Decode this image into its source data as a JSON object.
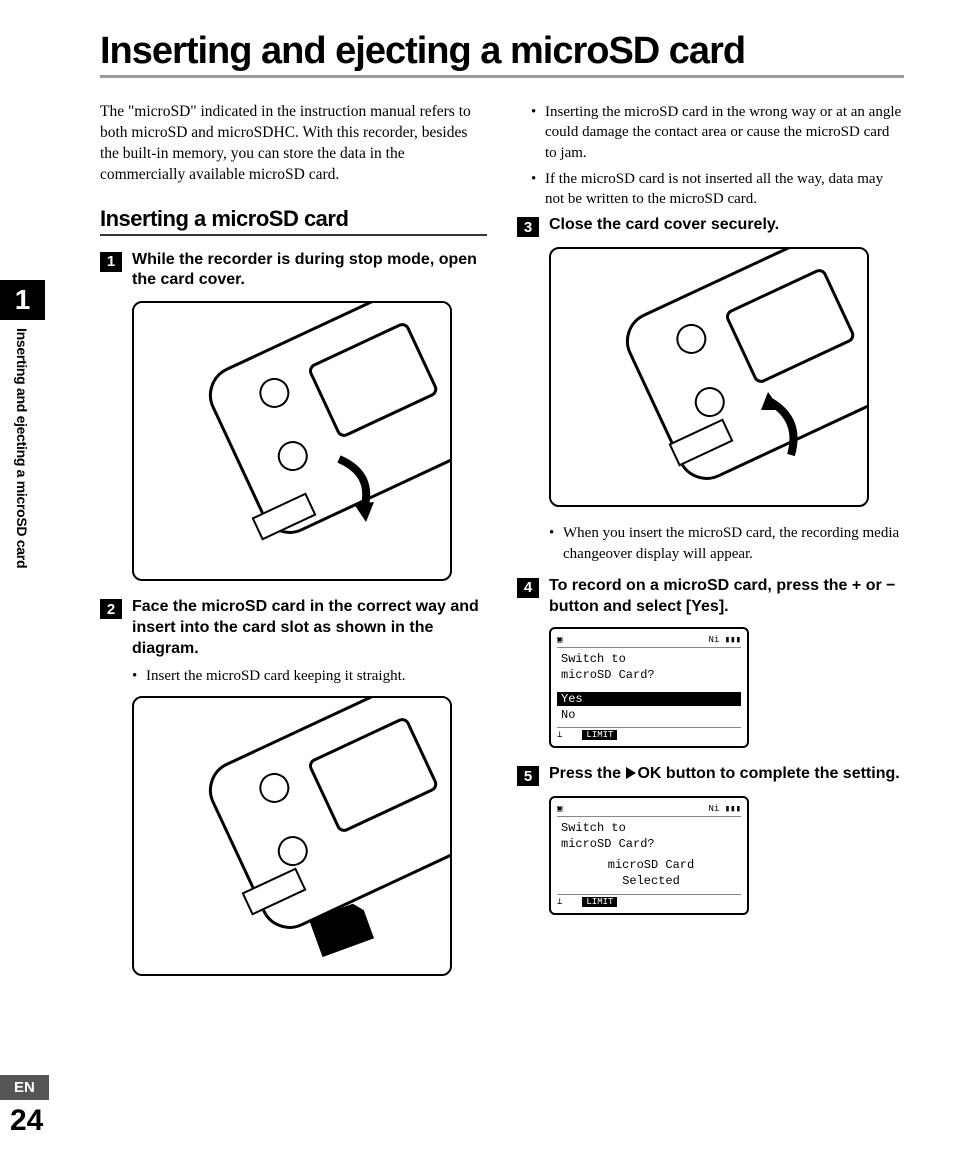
{
  "page_title": "Inserting and ejecting a microSD card",
  "intro": "The \"microSD\" indicated in the instruction manual refers to both microSD and microSDHC. With this recorder, besides the built-in memory, you can store the data in the commercially available microSD card.",
  "subsection": "Inserting a microSD card",
  "steps": {
    "s1": {
      "num": "1",
      "title": "While the recorder is during stop mode, open the card cover."
    },
    "s2": {
      "num": "2",
      "title": "Face the microSD card in the correct way and insert into the card slot as shown in the diagram.",
      "bullets": [
        "Insert the microSD card keeping it straight."
      ]
    },
    "s2_extra": [
      "Inserting the microSD card in the wrong way or at an angle could damage the contact area or cause the microSD card to jam.",
      "If the microSD card is not inserted all the way, data may not be written to the microSD card."
    ],
    "s3": {
      "num": "3",
      "title": "Close the card cover securely.",
      "bullets": [
        "When you insert the microSD card, the recording media changeover display will appear."
      ]
    },
    "s4": {
      "num": "4",
      "title_pre": "To record on a microSD card, press the + or − button and select [",
      "title_bold": "Yes",
      "title_post": "]."
    },
    "s5": {
      "num": "5",
      "title_pre": "Press the ",
      "title_mid": "OK",
      "title_post": " button to complete the setting."
    }
  },
  "lcd1": {
    "header_right": "Ni",
    "line1": "Switch to",
    "line2": "microSD Card?",
    "opt_yes": "Yes",
    "opt_no": "No",
    "footer_badge": "LIMIT"
  },
  "lcd2": {
    "header_right": "Ni",
    "line1": "Switch to",
    "line2": "microSD Card?",
    "result1": "microSD Card",
    "result2": "Selected",
    "footer_badge": "LIMIT"
  },
  "sidebar": {
    "chapter": "1",
    "label": "Inserting and ejecting a microSD card"
  },
  "footer": {
    "lang": "EN",
    "page": "24"
  }
}
